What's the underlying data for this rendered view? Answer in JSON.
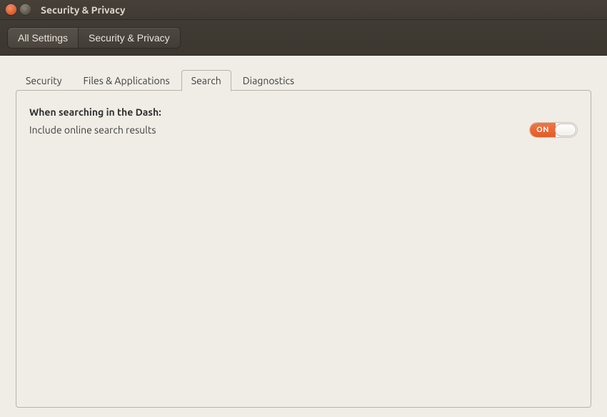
{
  "window": {
    "title": "Security & Privacy"
  },
  "toolbar": {
    "all_settings": "All Settings",
    "current": "Security & Privacy"
  },
  "tabs": {
    "security": "Security",
    "files_apps": "Files & Applications",
    "search": "Search",
    "diagnostics": "Diagnostics",
    "active": "search"
  },
  "search_panel": {
    "heading": "When searching in the Dash:",
    "option_label": "Include online search results",
    "toggle_state": "ON"
  }
}
